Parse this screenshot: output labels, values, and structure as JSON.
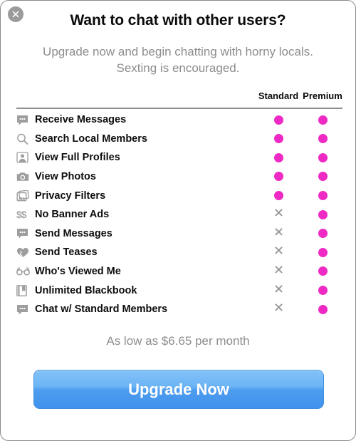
{
  "dialog": {
    "title": "Want to chat with other users?",
    "subtitle_line1": "Upgrade now and begin chatting with horny locals.",
    "subtitle_line2": "Sexting is encouraged.",
    "price_note": "As low as $6.65 per month",
    "cta_label": "Upgrade Now",
    "close_icon": "close-icon"
  },
  "colors": {
    "accent_dot": "#ee29c4",
    "cross": "#9a9a9a",
    "cta_top": "#83c2f8",
    "cta_bottom": "#3f92ec",
    "muted_text": "#8d8d8d"
  },
  "table": {
    "columns": [
      {
        "key": "standard",
        "label": "Standard"
      },
      {
        "key": "premium",
        "label": "Premium"
      }
    ],
    "rows": [
      {
        "icon": "speech-bubble-icon",
        "label": "Receive Messages",
        "standard": "included",
        "premium": "included"
      },
      {
        "icon": "magnifier-icon",
        "label": "Search Local Members",
        "standard": "included",
        "premium": "included"
      },
      {
        "icon": "profile-icon",
        "label": "View Full Profiles",
        "standard": "included",
        "premium": "included"
      },
      {
        "icon": "camera-icon",
        "label": "View Photos",
        "standard": "included",
        "premium": "included"
      },
      {
        "icon": "photos-icon",
        "label": "Privacy Filters",
        "standard": "included",
        "premium": "included"
      },
      {
        "icon": "dollars-icon",
        "label": "No Banner Ads",
        "standard": "excluded",
        "premium": "included"
      },
      {
        "icon": "speech-bubble-icon",
        "label": "Send Messages",
        "standard": "excluded",
        "premium": "included"
      },
      {
        "icon": "heart-icon",
        "label": "Send Teases",
        "standard": "excluded",
        "premium": "included"
      },
      {
        "icon": "glasses-icon",
        "label": "Who's Viewed Me",
        "standard": "excluded",
        "premium": "included"
      },
      {
        "icon": "book-icon",
        "label": "Unlimited Blackbook",
        "standard": "excluded",
        "premium": "included"
      },
      {
        "icon": "speech-bubble-icon",
        "label": "Chat w/ Standard Members",
        "standard": "excluded",
        "premium": "included"
      }
    ]
  }
}
